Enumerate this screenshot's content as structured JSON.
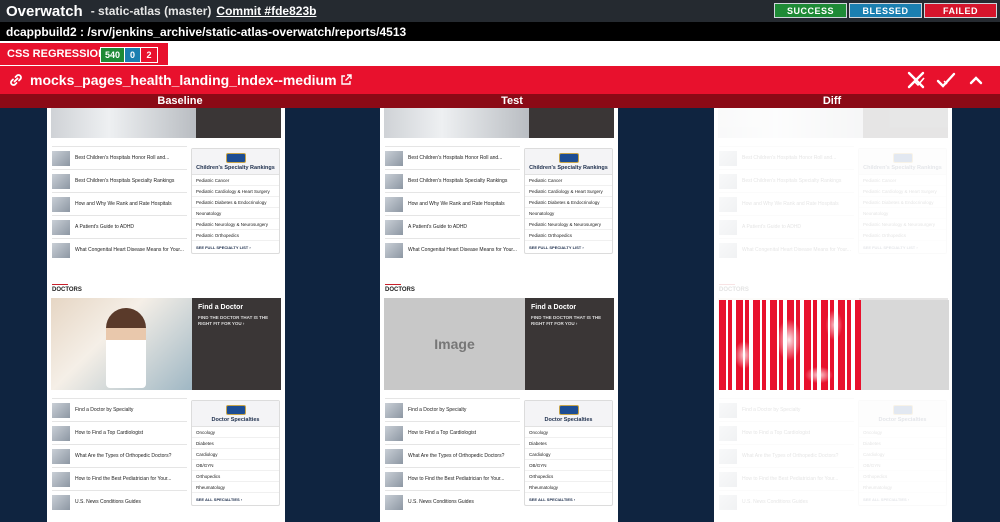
{
  "header": {
    "app_title": "Overwatch",
    "repo": "- static-atlas (master)",
    "commit": "Commit #fde823b",
    "statuses": {
      "success": "SUCCESS",
      "blessed": "BLESSED",
      "failed": "FAILED"
    }
  },
  "path": "dcappbuild2 : /srv/jenkins_archive/static-atlas-overwatch/reports/4513",
  "regression": {
    "label": "CSS REGRESSION",
    "pass_count": "540",
    "blessed_count": "0",
    "fail_count": "2"
  },
  "test": {
    "name": "mocks_pages_health_landing_index--medium",
    "icons": [
      "link-icon",
      "external-link-icon",
      "reject-icon",
      "bless-check-icon",
      "collapse-chevron-icon"
    ]
  },
  "columns": {
    "baseline": "Baseline",
    "test": "Test",
    "diff": "Diff"
  },
  "page": {
    "hospital_list": [
      "Best Children's Hospitals Honor Roll and...",
      "Best Children's Hospitals Specialty Rankings",
      "How and Why We Rank and Rate Hospitals",
      "A Patient's Guide to ADHD",
      "What Congenital Heart Disease Means for Your..."
    ],
    "rankings_title": "Children's Specialty Rankings",
    "rankings": [
      "Pediatric Cancer",
      "Pediatric Cardiology & Heart Surgery",
      "Pediatric Diabetes & Endocrinology",
      "Neonatology",
      "Pediatric Neurology & Neurosurgery",
      "Pediatric Orthopedics"
    ],
    "rankings_more": "SEE FULL SPECIALTY LIST ›",
    "doctors_label": "DOCTORS",
    "find_doctor_title": "Find a Doctor",
    "find_doctor_sub": "FIND THE DOCTOR THAT IS THE RIGHT FIT FOR YOU ›",
    "placeholder_text": "Image",
    "doctor_list": [
      "Find a Doctor by Specialty",
      "How to Find a Top Cardiologist",
      "What Are the Types of Orthopedic Doctors?",
      "How to Find the Best Pediatrician for Your...",
      "U.S. News Conditions Guides"
    ],
    "specialties_title": "Doctor Specialties",
    "specialties": [
      "Oncology",
      "Diabetes",
      "Cardiology",
      "OB/GYN",
      "Orthopedics",
      "Rheumatology"
    ],
    "specialties_more": "SEE ALL SPECIALTIES ›"
  },
  "colors": {
    "accent_red": "#e8112d",
    "dark_red": "#8b0a16",
    "navy": "#0f2440",
    "success": "#1e8a36",
    "blessed": "#1b7fb0"
  }
}
